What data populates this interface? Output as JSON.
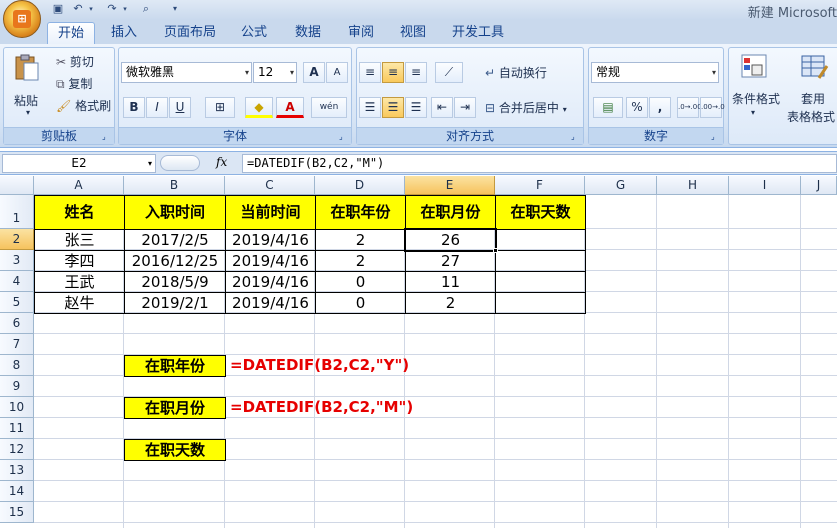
{
  "window": {
    "title": "新建 Microsoft"
  },
  "tabs": [
    "开始",
    "插入",
    "页面布局",
    "公式",
    "数据",
    "审阅",
    "视图",
    "开发工具"
  ],
  "clipboard": {
    "paste": "粘贴",
    "cut": "剪切",
    "copy": "复制",
    "format_painter": "格式刷",
    "label": "剪贴板"
  },
  "font": {
    "name": "微软雅黑",
    "size": "12",
    "grow": "A",
    "shrink": "A",
    "bold": "B",
    "italic": "I",
    "underline": "U",
    "border": "⊞",
    "fill": "◆",
    "color": "A",
    "wen": "wén",
    "label": "字体"
  },
  "alignment": {
    "wrap": "自动换行",
    "merge": "合并后居中",
    "label": "对齐方式"
  },
  "number": {
    "format": "常规",
    "percent": "%",
    "comma": ",",
    "inc": ".0→.00",
    "dec": ".00→.0",
    "label": "数字"
  },
  "styles": {
    "conditional": "条件格式",
    "table_a": "套用",
    "table_b": "表格格式"
  },
  "formula_bar": {
    "name_box": "E2",
    "fx": "fx",
    "formula": "=DATEDIF(B2,C2,\"M\")"
  },
  "columns": [
    "A",
    "B",
    "C",
    "D",
    "E",
    "F",
    "G",
    "H",
    "I",
    "J"
  ],
  "rows": [
    "1",
    "2",
    "3",
    "4",
    "5",
    "6",
    "7",
    "8",
    "9",
    "10",
    "11",
    "12",
    "13",
    "14",
    "15"
  ],
  "headers": [
    "姓名",
    "入职时间",
    "当前时间",
    "在职年份",
    "在职月份",
    "在职天数"
  ],
  "table": [
    [
      "张三",
      "2017/2/5",
      "2019/4/16",
      "2",
      "26",
      ""
    ],
    [
      "李四",
      "2016/12/25",
      "2019/4/16",
      "2",
      "27",
      ""
    ],
    [
      "王武",
      "2018/5/9",
      "2019/4/16",
      "0",
      "11",
      ""
    ],
    [
      "赵牛",
      "2019/2/1",
      "2019/4/16",
      "0",
      "2",
      ""
    ]
  ],
  "notes": [
    {
      "label": "在职年份",
      "formula": "=DATEDIF(B2,C2,\"Y\")"
    },
    {
      "label": "在职月份",
      "formula": "=DATEDIF(B2,C2,\"M\")"
    },
    {
      "label": "在职天数",
      "formula": ""
    }
  ],
  "colors": {
    "highlight": "#ffff00",
    "formula_text": "#e60000",
    "selected_header": "#f6c35e"
  }
}
